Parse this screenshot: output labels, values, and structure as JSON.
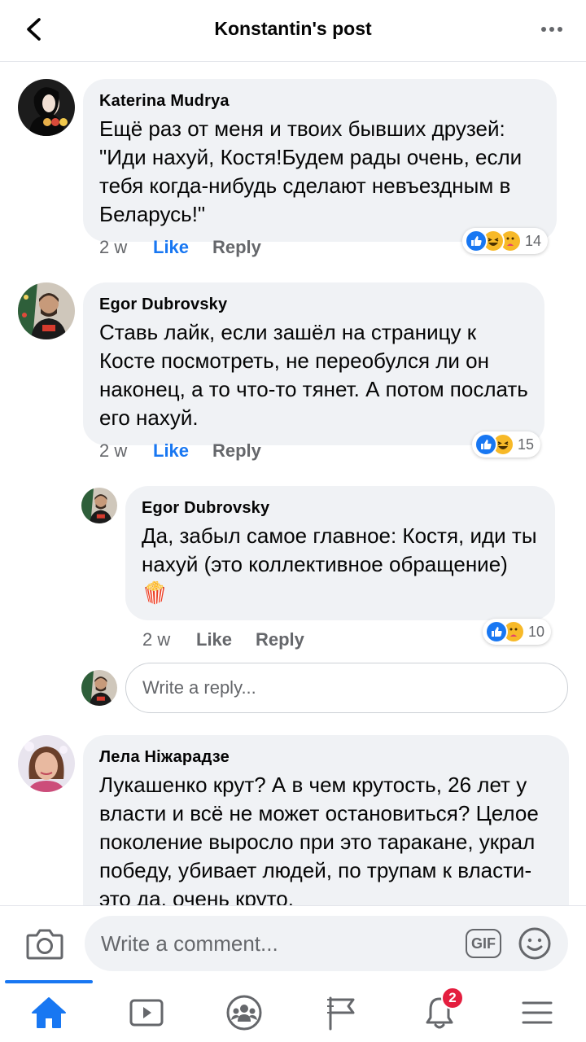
{
  "header": {
    "title": "Konstantin's post"
  },
  "comments": [
    {
      "author": "Katerina  Mudrya",
      "text": "Ещё раз от меня и твоих бывших друзей: \"Иди нахуй, Костя!Будем рады очень, если тебя когда-нибудь сделают невъездным в Беларусь!\"",
      "time": "2 w",
      "like_label": "Like",
      "reply_label": "Reply",
      "reaction_count": "14",
      "reactions": [
        "like-icon",
        "haha-icon",
        "care-icon"
      ],
      "liked": true
    },
    {
      "author": "Egor Dubrovsky",
      "text": "Ставь лайк, если зашёл на страницу к Косте посмотреть, не переобулся ли он наконец, а то что-то тянет. А потом послать его нахуй.",
      "time": "2 w",
      "like_label": "Like",
      "reply_label": "Reply",
      "reaction_count": "15",
      "reactions": [
        "like-icon",
        "haha-icon"
      ],
      "liked": true
    },
    {
      "author": "Egor Dubrovsky",
      "text": "Да, забыл самое главное: Костя, иди ты нахуй (это коллективное обращение) 🍿",
      "time": "2 w",
      "like_label": "Like",
      "reply_label": "Reply",
      "reaction_count": "10",
      "reactions": [
        "like-icon",
        "care-icon"
      ],
      "liked": false
    },
    {
      "author": "Лела Ніжарадзе",
      "text": "Лукашенко крут? А в чем крутость, 26 лет у власти и всё не может остановиться? Целое поколение выросло при это таракане, украл победу, убивает людей, по трупам к власти- это да, очень круто."
    }
  ],
  "reply_box": {
    "placeholder": "Write a reply..."
  },
  "composer": {
    "placeholder": "Write a comment...",
    "gif_label": "GIF"
  },
  "tabbar": {
    "active": "home",
    "notifications_badge": "2",
    "accent": "#1877f2",
    "tabs": [
      "home-icon",
      "watch-icon",
      "groups-icon",
      "pages-flag-icon",
      "notifications-bell-icon",
      "menu-icon"
    ]
  },
  "colors": {
    "accent": "#1877f2",
    "bubble": "#f0f2f5",
    "secondary_text": "#65676b",
    "badge": "#e41e3f"
  }
}
